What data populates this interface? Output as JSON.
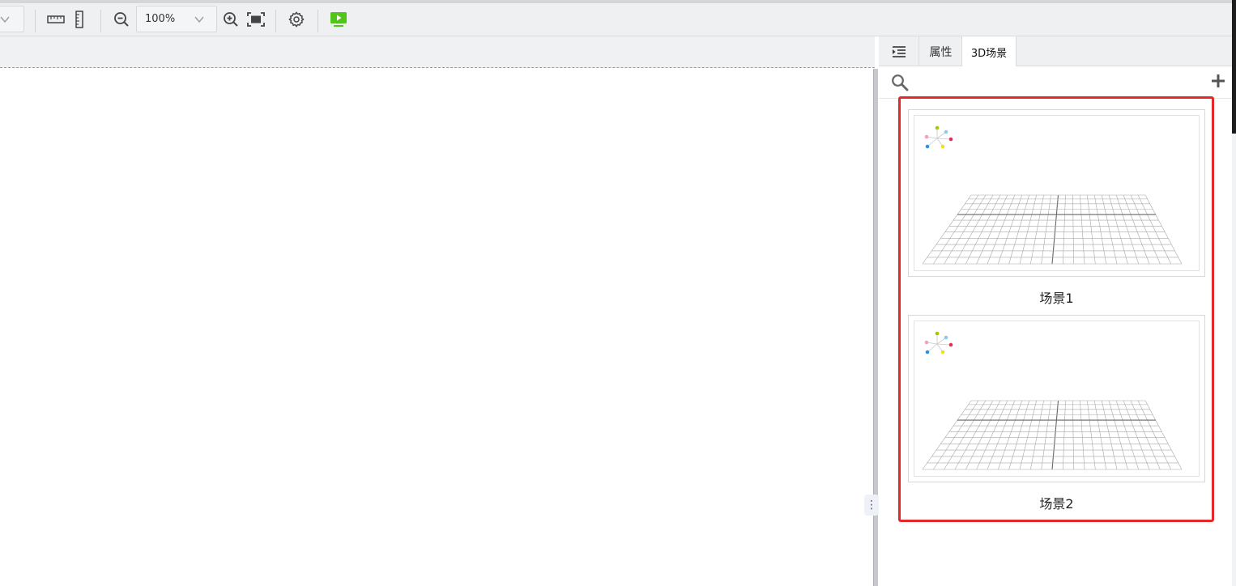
{
  "toolbar": {
    "zoom_value": "100%",
    "icons": [
      "chevron-down-icon",
      "ruler-horizontal-icon",
      "ruler-vertical-icon",
      "zoom-out-icon",
      "zoom-in-icon",
      "fit-screen-icon",
      "settings-gear-icon",
      "preview-play-icon"
    ],
    "preview_color": "#52c41a"
  },
  "panel": {
    "tabs": [
      {
        "label": "属性",
        "active": false
      },
      {
        "label": "3D场景",
        "active": true
      }
    ],
    "icons": [
      "outline-list-icon",
      "search-icon",
      "add-icon"
    ],
    "scenes": [
      {
        "label": "场景1"
      },
      {
        "label": "场景2"
      }
    ],
    "highlight_color": "#e62828"
  },
  "splitter": {
    "handle_glyph": "⋮"
  }
}
